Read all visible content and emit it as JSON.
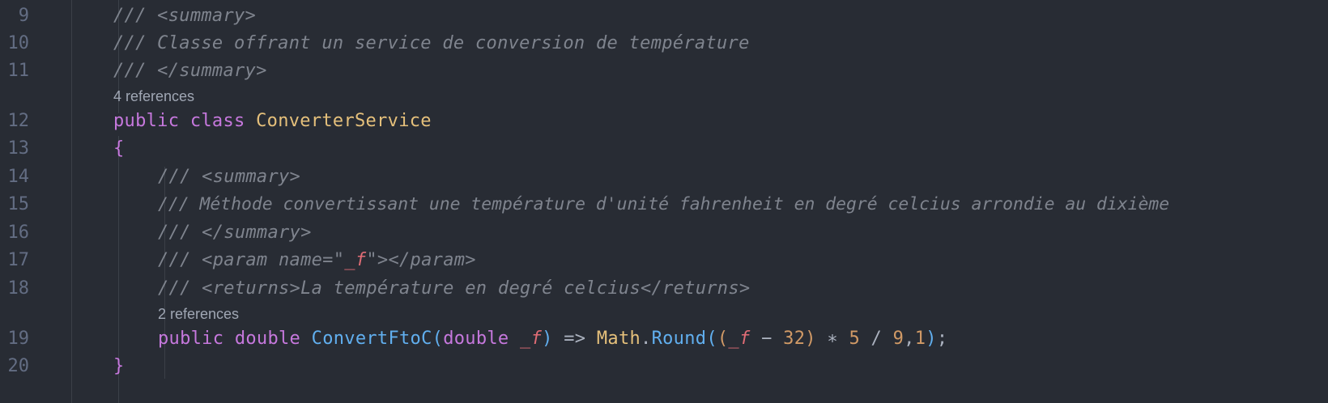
{
  "editor": {
    "lines": [
      {
        "n": "9",
        "text": "/// <summary>"
      },
      {
        "n": "10",
        "text": "/// Classe offrant un service de conversion de température"
      },
      {
        "n": "11",
        "text": "/// </summary>"
      },
      {
        "n": "12",
        "kw1": "public",
        "kw2": "class",
        "type": "ConverterService"
      },
      {
        "n": "13",
        "brace": "{"
      },
      {
        "n": "14",
        "text": "/// <summary>"
      },
      {
        "n": "15",
        "text": "/// Méthode convertissant une température d'unité fahrenheit en degré celcius arrondie au dixième"
      },
      {
        "n": "16",
        "text": "/// </summary>"
      },
      {
        "n": "17",
        "pre": "/// <param name=\"",
        "param": "_f",
        "post": "\"></param>"
      },
      {
        "n": "18",
        "text": "/// <returns>La température en degré celcius</returns>"
      },
      {
        "n": "19",
        "kw1": "public",
        "kw2": "double",
        "method": "ConvertFtoC",
        "open1": "(",
        "ptype": "double",
        "pname": "_f",
        "close1": ")",
        "arrow": "=>",
        "cls": "Math",
        "dot": ".",
        "call": "Round",
        "open2": "(",
        "open3": "(",
        "var": "_f",
        "minus": "−",
        "n32": "32",
        "close3": ")",
        "star": "∗",
        "n5": "5",
        "slash": "/",
        "n9": "9",
        "comma": ",",
        "n1": "1",
        "close2": ")",
        "semi": ";"
      },
      {
        "n": "20",
        "brace": "}"
      }
    ],
    "lens_class": "4 references",
    "lens_method": "2 references"
  }
}
